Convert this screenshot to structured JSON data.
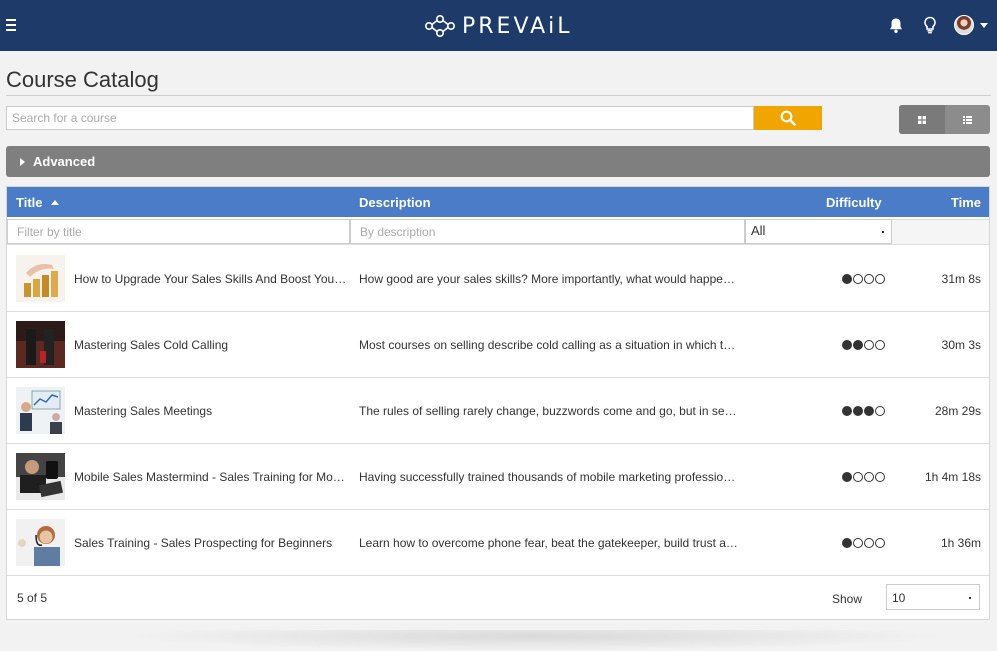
{
  "brand": {
    "name": "PREVAiL"
  },
  "header": {
    "menu_icon": "hamburger-icon",
    "icons": [
      "bell-icon",
      "lightbulb-icon",
      "user-avatar"
    ]
  },
  "page": {
    "title": "Course Catalog"
  },
  "search": {
    "placeholder": "Search for a course",
    "value": ""
  },
  "advanced": {
    "label": "Advanced"
  },
  "table": {
    "columns": {
      "title": "Title",
      "description": "Description",
      "difficulty": "Difficulty",
      "time": "Time"
    },
    "filters": {
      "title_placeholder": "Filter by title",
      "description_placeholder": "By description",
      "difficulty_value": "All"
    },
    "rows": [
      {
        "title": "How to Upgrade Your Sales Skills And Boost Your Sales Income",
        "description": "How good are your sales skills? More importantly, what would happen if you improved them?",
        "difficulty": 1,
        "time": "31m 8s"
      },
      {
        "title": "Mastering Sales Cold Calling",
        "description": "Most courses on selling describe cold calling as a situation in which the salesperson calls",
        "difficulty": 2,
        "time": "30m 3s"
      },
      {
        "title": "Mastering Sales Meetings",
        "description": "The rules of selling rarely change, buzzwords come and go, but in selling the basics remain",
        "difficulty": 3,
        "time": "28m 29s"
      },
      {
        "title": "Mobile Sales Mastermind - Sales Training for Mobile Marketers",
        "description": "Having successfully trained thousands of mobile marketing professionals around the world",
        "difficulty": 1,
        "time": "1h 4m 18s"
      },
      {
        "title": "Sales Training - Sales Prospecting for Beginners",
        "description": "Learn how to overcome phone fear, beat the gatekeeper, build trust and close more sales",
        "difficulty": 1,
        "time": "1h 36m"
      }
    ],
    "difficulty_max": 4
  },
  "footer": {
    "count": "5 of 5",
    "show_label": "Show",
    "page_size": "10"
  }
}
